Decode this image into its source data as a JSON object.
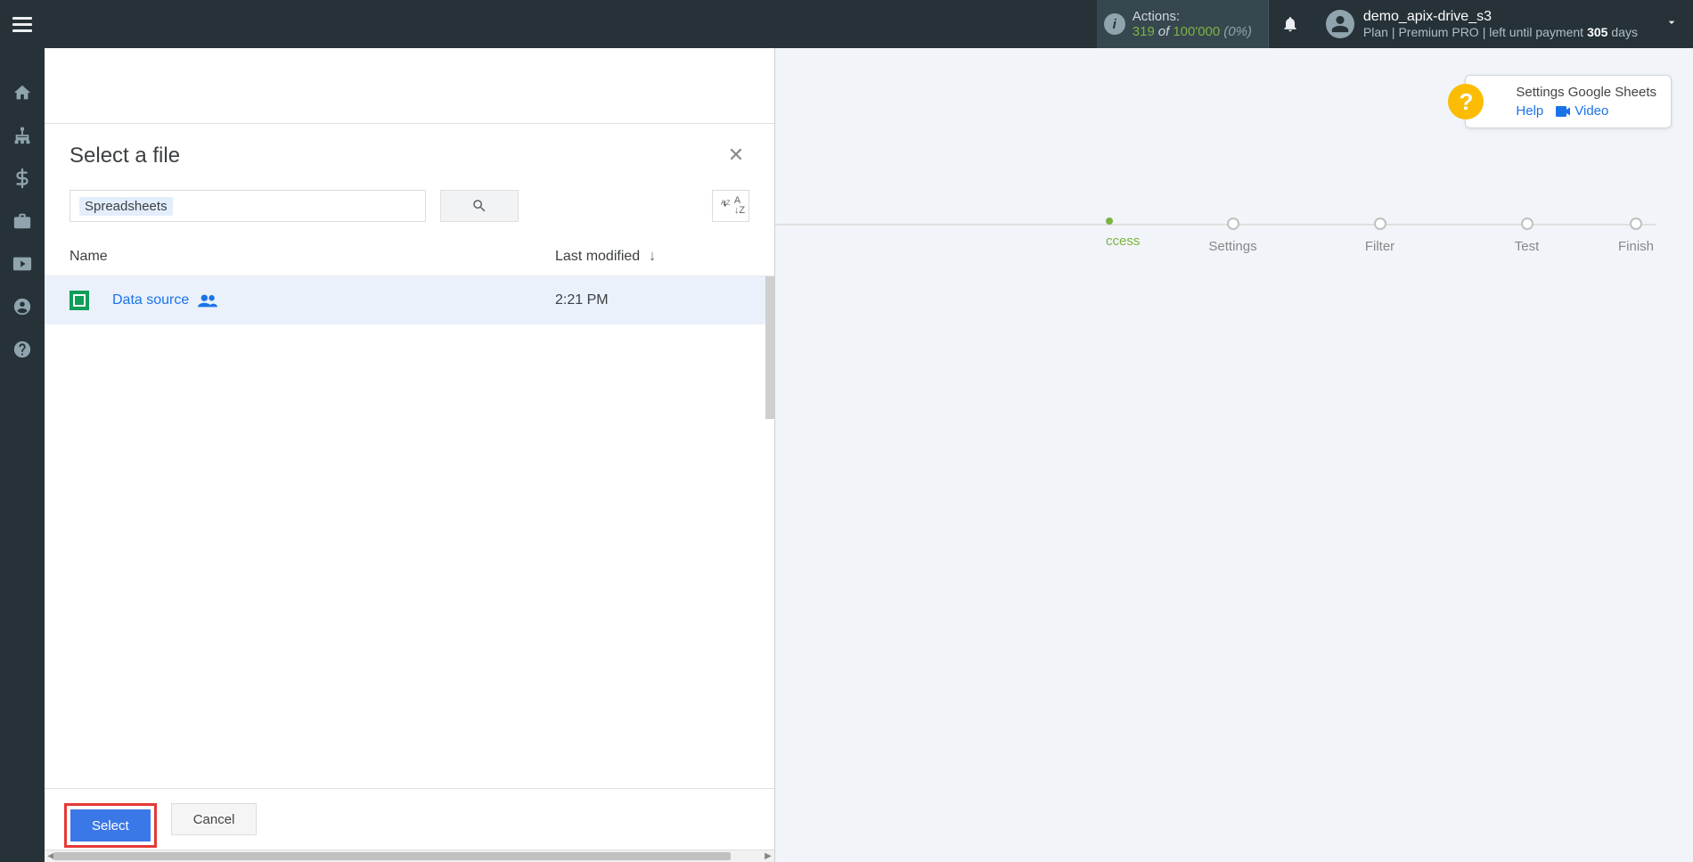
{
  "header": {
    "actions_label": "Actions:",
    "actions_used": "319",
    "actions_of": "of",
    "actions_total": "100'000",
    "actions_pct": "(0%)",
    "user_name": "demo_apix-drive_s3",
    "plan_prefix": "Plan |",
    "plan_name": "Premium PRO",
    "plan_suffix": "| left until payment",
    "days": "305",
    "days_word": "days"
  },
  "help_card": {
    "title": "Settings Google Sheets",
    "help_link": "Help",
    "video_link": "Video"
  },
  "wizard": {
    "steps": [
      "ccess",
      "Settings",
      "Filter",
      "Test",
      "Finish"
    ]
  },
  "picker": {
    "title": "Select a file",
    "filter_chip": "Spreadsheets",
    "col_name": "Name",
    "col_modified": "Last modified",
    "file_name": "Data source",
    "file_modified": "2:21 PM",
    "select_btn": "Select",
    "cancel_btn": "Cancel"
  }
}
